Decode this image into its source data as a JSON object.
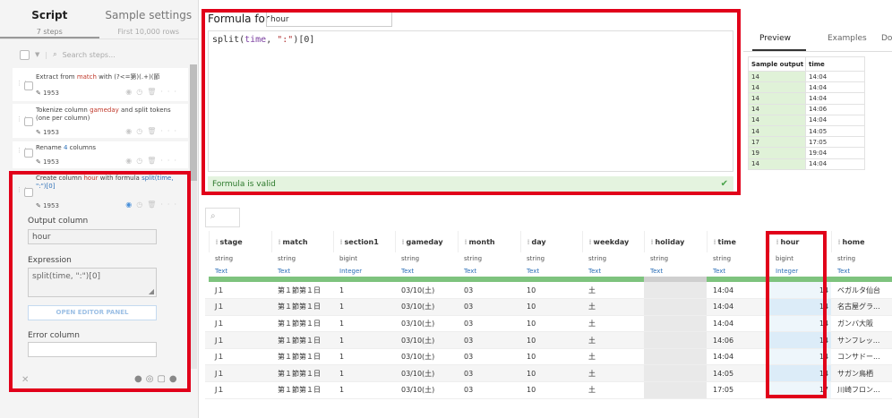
{
  "left_panel": {
    "tabs": [
      {
        "label": "Script",
        "sub": "7 steps"
      },
      {
        "label": "Sample settings",
        "sub": "First 10,000 rows"
      }
    ],
    "search_placeholder": "Search steps...",
    "steps": [
      {
        "title_pre": "Extract from ",
        "title_hl": "match",
        "title_post": " with (?<=第)(.+)(節",
        "version": "1953"
      },
      {
        "title_pre": "Tokenize column ",
        "title_hl": "gameday",
        "title_post": " and split tokens (one per column)",
        "version": "1953"
      },
      {
        "title_pre": "Rename ",
        "title_hl": "4",
        "title_post": " columns",
        "version": "1953"
      },
      {
        "title_pre": "Create column ",
        "title_hl": "hour",
        "title_mid": " with formula ",
        "title_hl2": "split(time, \":\")[0]",
        "version": "1953"
      }
    ],
    "edit_form": {
      "output_column_label": "Output column",
      "output_column_value": "hour",
      "expression_label": "Expression",
      "expression_value": "split(time, \":\")[0]",
      "open_editor_label": "OPEN EDITOR PANEL",
      "error_column_label": "Error column",
      "error_column_value": ""
    }
  },
  "formula_editor": {
    "label": "Formula for",
    "column_name": "hour",
    "code_fn": "split(",
    "code_var": "time",
    "code_sep": ", ",
    "code_str": "\":\"",
    "code_end": ")[0]",
    "status": "Formula is valid"
  },
  "preview": {
    "tabs": [
      "Preview",
      "Examples",
      "Do"
    ],
    "headers": [
      "Sample output",
      "time"
    ],
    "rows": [
      [
        "14",
        "14:04"
      ],
      [
        "14",
        "14:04"
      ],
      [
        "14",
        "14:04"
      ],
      [
        "14",
        "14:06"
      ],
      [
        "14",
        "14:04"
      ],
      [
        "14",
        "14:05"
      ],
      [
        "17",
        "17:05"
      ],
      [
        "19",
        "19:04"
      ],
      [
        "14",
        "14:04"
      ]
    ]
  },
  "grid": {
    "columns": [
      "",
      "stage",
      "match",
      "section1",
      "gameday",
      "month",
      "day",
      "weekday",
      "holiday",
      "time",
      "hour",
      "home"
    ],
    "types": [
      "",
      "string",
      "string",
      "bigint",
      "string",
      "string",
      "string",
      "string",
      "string",
      "string",
      "bigint",
      "string"
    ],
    "semantics": [
      "",
      "Text",
      "Text",
      "Integer",
      "Text",
      "Text",
      "Text",
      "Text",
      "Text",
      "Text",
      "Integer",
      "Text"
    ],
    "rows": [
      [
        "J１",
        "第１節第１日",
        "1",
        "03/10(土)",
        "03",
        "10",
        "土",
        "",
        "14:04",
        "14",
        "ベガルタ仙台"
      ],
      [
        "J１",
        "第１節第１日",
        "1",
        "03/10(土)",
        "03",
        "10",
        "土",
        "",
        "14:04",
        "14",
        "名古屋グラ..."
      ],
      [
        "J１",
        "第１節第１日",
        "1",
        "03/10(土)",
        "03",
        "10",
        "土",
        "",
        "14:04",
        "14",
        "ガンバ大阪"
      ],
      [
        "J１",
        "第１節第１日",
        "1",
        "03/10(土)",
        "03",
        "10",
        "土",
        "",
        "14:06",
        "14",
        "サンフレッ..."
      ],
      [
        "J１",
        "第１節第１日",
        "1",
        "03/10(土)",
        "03",
        "10",
        "土",
        "",
        "14:04",
        "14",
        "コンサドー..."
      ],
      [
        "J１",
        "第１節第１日",
        "1",
        "03/10(土)",
        "03",
        "10",
        "土",
        "",
        "14:05",
        "14",
        "サガン鳥栖"
      ],
      [
        "J１",
        "第１節第１日",
        "1",
        "03/10(土)",
        "03",
        "10",
        "土",
        "",
        "17:05",
        "17",
        "川崎フロン..."
      ]
    ]
  }
}
